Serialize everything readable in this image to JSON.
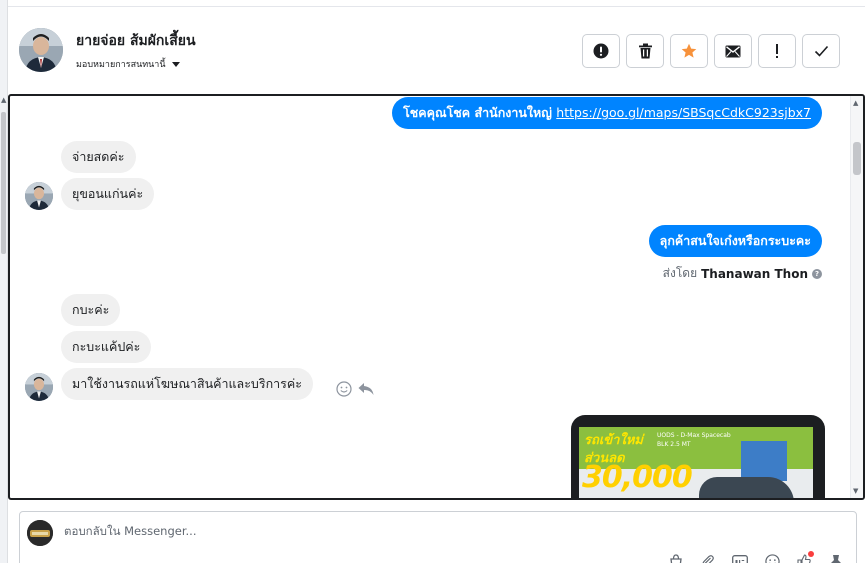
{
  "header": {
    "contact_name": "ยายจ่อย ส้มผักเสี้ยน",
    "assign_label": "มอบหมายการสนทนานี้",
    "actions": [
      {
        "icon": "alert-circle-icon"
      },
      {
        "icon": "trash-icon"
      },
      {
        "icon": "star-icon",
        "color": "#f7923b"
      },
      {
        "icon": "envelope-icon"
      },
      {
        "icon": "exclamation-icon"
      },
      {
        "icon": "checkmark-icon"
      }
    ]
  },
  "conversation": {
    "messages": [
      {
        "from": "page",
        "text": "โชคคุณโชค สำนักงานใหญ่ ",
        "link": "https://goo.gl/maps/SBSqcCdkC923sjbx7"
      },
      {
        "from": "customer",
        "text": "จ่ายสดค่ะ"
      },
      {
        "from": "customer",
        "text": "ยุขอนแก่นค่ะ"
      },
      {
        "from": "page",
        "text": "ลุกค้าสนใจเก๋งหรือกระบะคะ"
      },
      {
        "from": "customer",
        "text": "กบะค่ะ"
      },
      {
        "from": "customer",
        "text": "กะบะแค้ปค่ะ"
      },
      {
        "from": "customer",
        "text": "มาใช้งานรถแห่โฆษณาสินค้าและบริการค่ะ"
      }
    ],
    "sent_by_label": "ส่งโดย",
    "sent_by_name": "Thanawan Thon",
    "ad_card": {
      "line1": "รถเข้าใหม่",
      "line2": "ส่วนลด",
      "model": "UODS - D-Max Spacecab",
      "spec": "BLK 2.5 MT",
      "amount": "30,000"
    }
  },
  "composer": {
    "placeholder": "ตอบกลับใน Messenger...",
    "tools": [
      "bag-icon",
      "attachment-icon",
      "gif-icon",
      "emoji-icon",
      "like-icon",
      "pin-icon"
    ]
  },
  "colors": {
    "outgoing_bubble": "#0084ff",
    "incoming_bubble": "#f0f0f0"
  }
}
